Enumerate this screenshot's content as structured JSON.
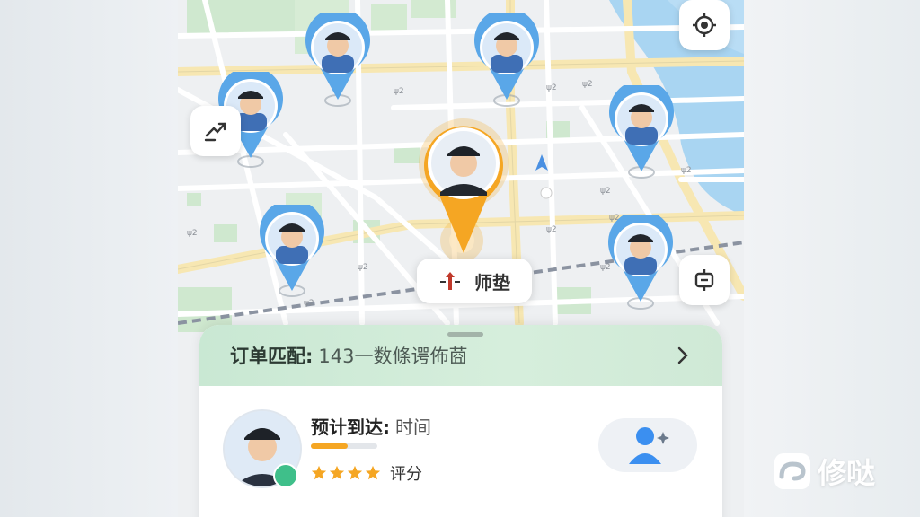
{
  "map": {
    "location_chip_label": "师垫",
    "accent_color": "#f5a623",
    "pin_color": "#4a90e2"
  },
  "buttons": {
    "locate_icon": "crosshair-icon",
    "route_icon": "route-arrows-icon",
    "service_icon": "chat-bubble-icon"
  },
  "sheet": {
    "order_key": "订单匹配:",
    "order_value": "143一数條谔佈莔"
  },
  "driver": {
    "eta_label": "预计到达:",
    "eta_value": "时间",
    "eta_progress": 0.55,
    "stars": 4,
    "rating_label": "评分"
  },
  "brand": {
    "name": "修哒"
  }
}
